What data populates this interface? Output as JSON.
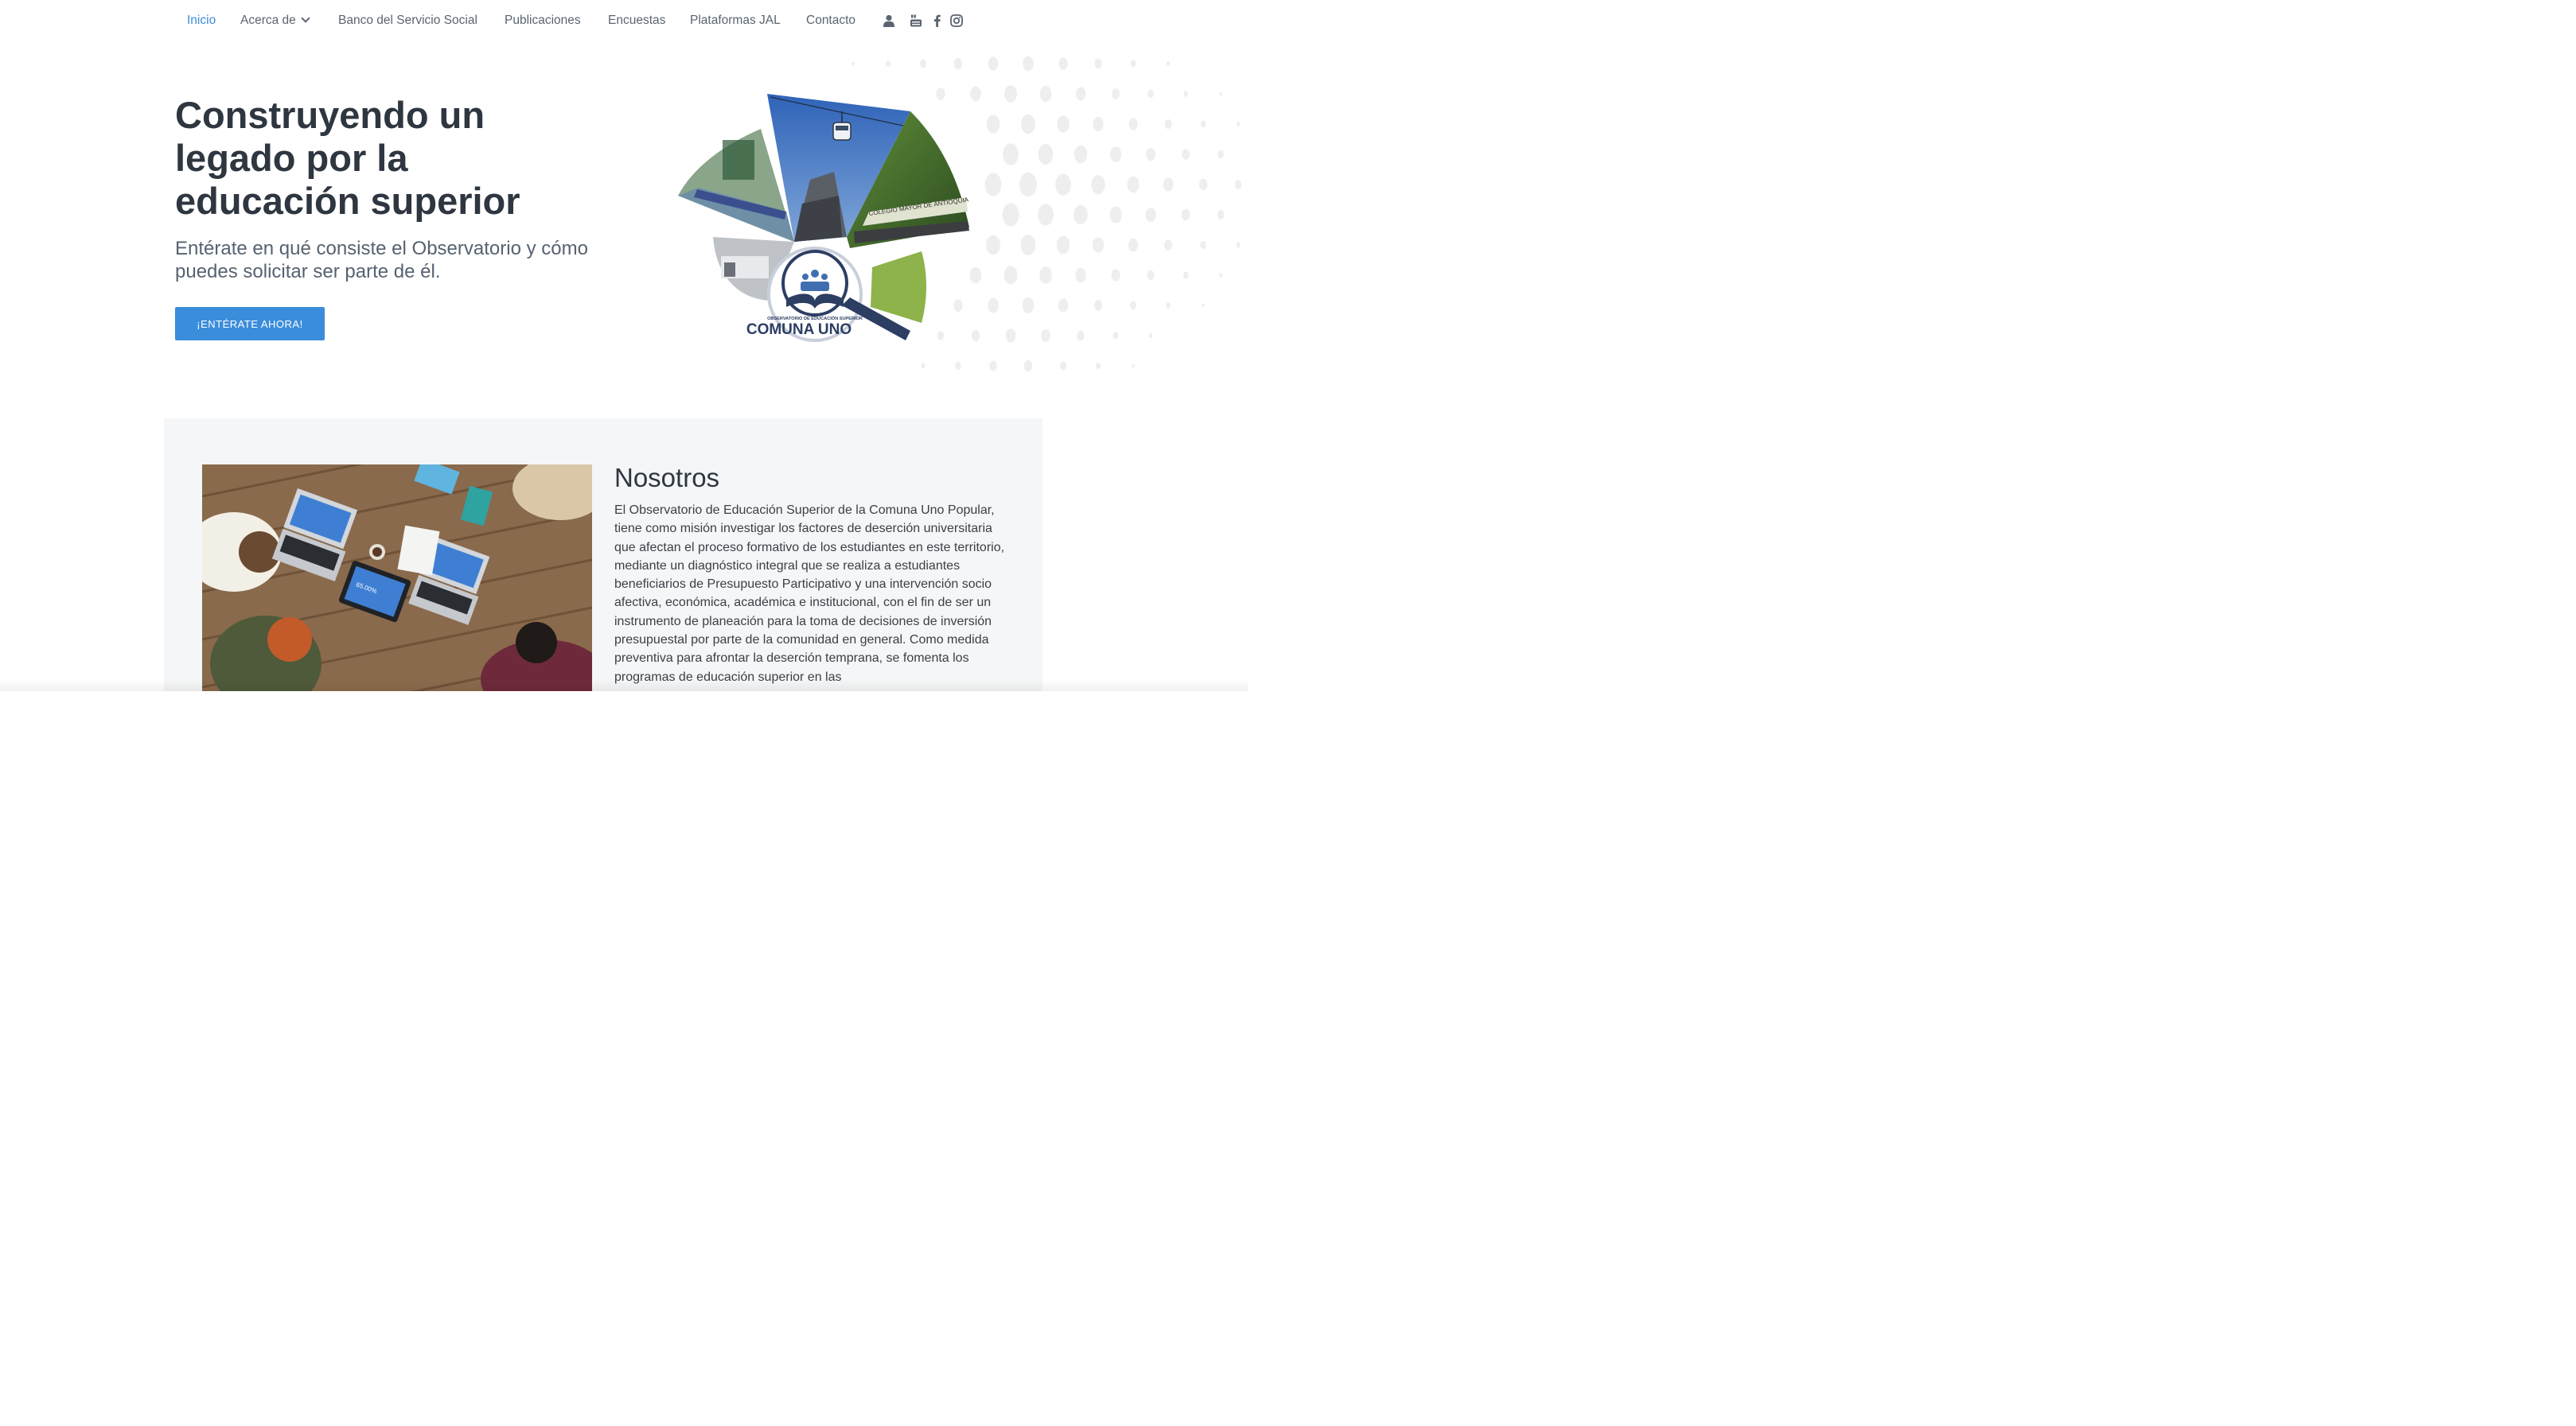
{
  "nav": {
    "items": [
      "Inicio",
      "Acerca de",
      "Banco del Servicio Social",
      "Publicaciones",
      "Encuestas",
      "Plataformas JAL",
      "Contacto"
    ],
    "active": "Inicio",
    "social_icons": [
      "user-icon",
      "youtube-icon",
      "facebook-icon",
      "instagram-icon"
    ]
  },
  "hero": {
    "title": "Construyendo un legado por la educación superior",
    "subtitle": "Entérate en qué consiste el Observatorio y cómo puedes solicitar ser parte de él.",
    "cta_label": "¡ENTÉRATE AHORA!",
    "logo_small": "OBSERVATORIO DE EDUCACIÓN SUPERIOR",
    "logo_big": "COMUNA UNO",
    "building_sign": "COLEGIO MAYOR DE ANTIOQUIA"
  },
  "about": {
    "title": "Nosotros",
    "text": "El Observatorio de Educación Superior de la Comuna Uno Popular, tiene como misión investigar los factores de deserción universitaria que afectan el proceso formativo de los estudiantes en este territorio, mediante un diagnóstico integral que se realiza a estudiantes beneficiarios de Presupuesto Participativo y una intervención socio afectiva, económica, académica e institucional, con el fin de ser un instrumento de planeación para la toma de decisiones de inversión presupuestal por parte de la comunidad en general. Como medida preventiva para afrontar la deserción temprana, se fomenta los programas de educación superior en las",
    "tablet_text": "65.00%"
  },
  "colors": {
    "accent": "#3a8ddb",
    "heading": "#2e3640",
    "green": "#8db34a",
    "section_bg": "#f5f6f7"
  }
}
